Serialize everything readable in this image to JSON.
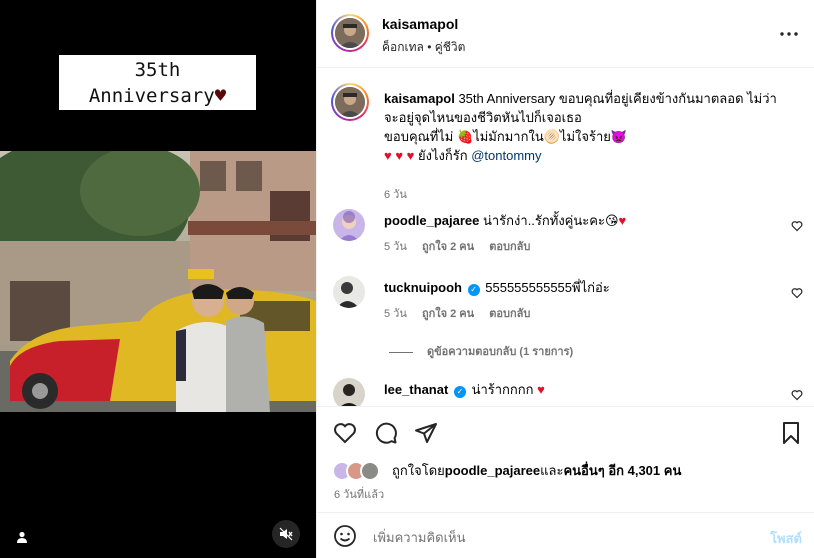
{
  "media": {
    "overlay_line1": "35th",
    "overlay_line2": "Anniversary",
    "overlay_heart": "♥"
  },
  "post_header": {
    "username": "kaisamapol",
    "subtitle": "ค็อกเทล • คู่ชีวิต",
    "more_icon": "more-horizontal-icon"
  },
  "caption": {
    "username": "kaisamapol",
    "text_1": "35th Anniversary ขอบคุณที่อยู่เคียงข้างกันมาตลอด ไม่ว่าจะอยู่จุดไหนของชีวิตหันไปก็เจอเธอ",
    "text_2a": "ขอบคุณที่ไม่ ",
    "emoji_strawberry": "🍓",
    "text_2b": "ไม่มักมากใน",
    "emoji_plantain": "🫓",
    "text_2c": "ไม่ใจร้าย",
    "emoji_devil": "👿",
    "hearts": "♥ ♥ ♥",
    "text_3": " ยังไงก็รัก ",
    "mention": "@tontommy",
    "time": "6 วัน"
  },
  "comments": [
    {
      "username": "poodle_pajaree",
      "verified": false,
      "text": "น่ารักง่า..รักทั้งคู่นะคะ",
      "emoji": "😘",
      "heart": "♥",
      "time": "5 วัน",
      "likes": "ถูกใจ 2 คน",
      "reply": "ตอบกลับ"
    },
    {
      "username": "tucknuipooh",
      "verified": true,
      "text": "555555555555พี่ไก่อ่ะ",
      "emoji": "",
      "heart": "",
      "time": "5 วัน",
      "likes": "ถูกใจ 2 คน",
      "reply": "ตอบกลับ",
      "view_replies": "ดูข้อความตอบกลับ (1 รายการ)"
    },
    {
      "username": "lee_thanat",
      "verified": true,
      "text": "น่าร้ากกกก",
      "emoji": "",
      "heart": "♥",
      "time": "",
      "likes": "",
      "reply": ""
    }
  ],
  "actions": {
    "like_icon": "heart-outline-icon",
    "comment_icon": "comment-bubble-icon",
    "share_icon": "paper-plane-icon",
    "save_icon": "bookmark-icon"
  },
  "likes": {
    "prefix": "ถูกใจโดย ",
    "user": "poodle_pajaree",
    "middle": " และ",
    "others": "คนอื่นๆ อีก 4,301 คน"
  },
  "posted_ago": "6 วันที่แล้ว",
  "comment_box": {
    "placeholder": "เพิ่มความคิดเห็น",
    "post_label": "โพสต์"
  },
  "colors": {
    "verified": "#0095f6",
    "post_button": "#b2dffc",
    "heart_red": "#e0102b"
  }
}
